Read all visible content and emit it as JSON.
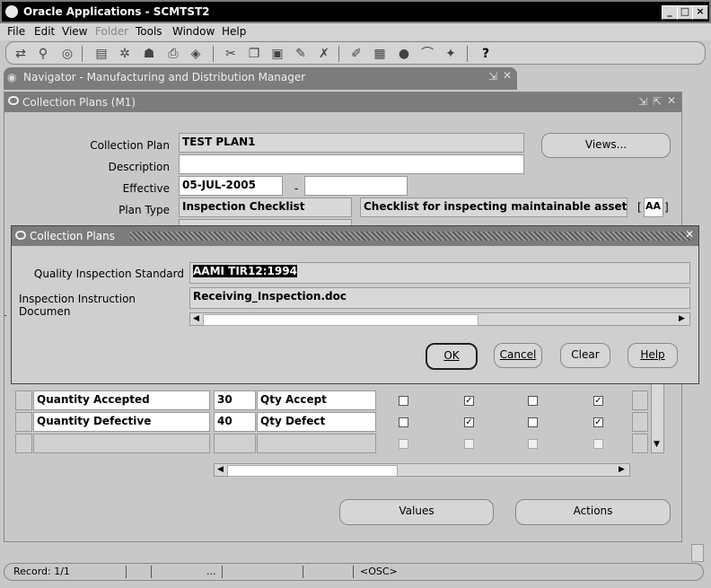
{
  "window": {
    "title": "Oracle Applications - SCMTST2"
  },
  "menu": [
    "File",
    "Edit",
    "View",
    "Folder",
    "Tools",
    "Window",
    "Help"
  ],
  "navigator": {
    "title": "Navigator - Manufacturing and Distribution Manager"
  },
  "collection_plans_window": {
    "title": "Collection Plans (M1)",
    "labels": {
      "collection_plan": "Collection Plan",
      "description": "Description",
      "effective": "Effective",
      "plan_type": "Plan Type"
    },
    "values": {
      "collection_plan": "TEST PLAN1",
      "description": "",
      "effective_from": "05-JUL-2005",
      "effective_dash": "-",
      "effective_to": "",
      "plan_type": "Inspection Checklist",
      "plan_type_desc": "Checklist for inspecting maintainable assets",
      "bracket_open": "[",
      "bracket_close": "]",
      "aa_label": "AA"
    },
    "views_button": "Views...",
    "rows": [
      {
        "element": "Quantity Accepted",
        "seq": "30",
        "prompt": "Qty Accept",
        "c1": false,
        "c2": true,
        "c3": false,
        "c4": true
      },
      {
        "element": "Quantity Defective",
        "seq": "40",
        "prompt": "Qty Defect",
        "c1": false,
        "c2": true,
        "c3": false,
        "c4": true
      }
    ],
    "values_button": "Values",
    "actions_button": "Actions"
  },
  "dialog": {
    "title": "Collection Plans",
    "labels": {
      "quality_standard": "Quality Inspection Standard",
      "instruction_doc": "Inspection Instruction Documen"
    },
    "values": {
      "quality_standard": "AAMI TIR12:1994",
      "instruction_doc": "Receiving_Inspection.doc"
    },
    "buttons": {
      "ok": "OK",
      "cancel": "Cancel",
      "clear": "Clear",
      "help": "Help"
    }
  },
  "status": {
    "record": "Record: 1/1",
    "ellipsis": "...",
    "osc": "<OSC>"
  }
}
